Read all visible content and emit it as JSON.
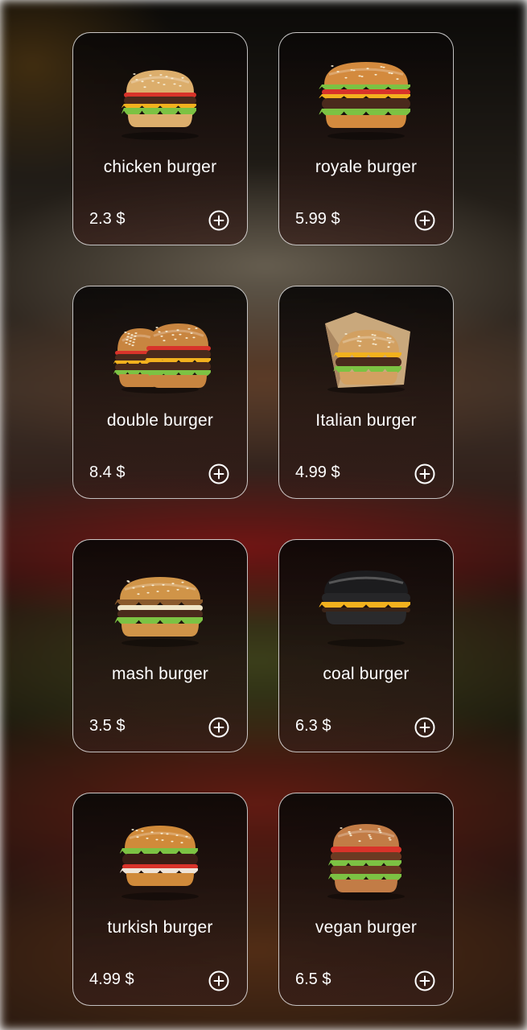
{
  "products": [
    {
      "name": "chicken burger",
      "price": "2.3 $",
      "icon": "chicken-burger-image",
      "style": "classic"
    },
    {
      "name": "royale burger",
      "price": "5.99 $",
      "icon": "royale-burger-image",
      "style": "royale"
    },
    {
      "name": "double burger",
      "price": "8.4 $",
      "icon": "double-burger-image",
      "style": "double"
    },
    {
      "name": "Italian burger",
      "price": "4.99 $",
      "icon": "italian-burger-image",
      "style": "wrapped"
    },
    {
      "name": "mash burger",
      "price": "3.5 $",
      "icon": "mash-burger-image",
      "style": "mash"
    },
    {
      "name": "coal burger",
      "price": "6.3 $",
      "icon": "coal-burger-image",
      "style": "coal"
    },
    {
      "name": "turkish burger",
      "price": "4.99 $",
      "icon": "turkish-burger-image",
      "style": "turkish"
    },
    {
      "name": "vegan burger",
      "price": "6.5 $",
      "icon": "vegan-burger-image",
      "style": "vegan"
    }
  ],
  "add_icon": "plus-circle-icon",
  "colors": {
    "card_border": "#ffffff",
    "text": "#ffffff",
    "bun": "#d9a55c",
    "patty": "#4a2a1c",
    "lettuce": "#7cc243",
    "tomato": "#d8332a",
    "cheese": "#f2b11e",
    "coal_bun": "#1c1c1e"
  }
}
